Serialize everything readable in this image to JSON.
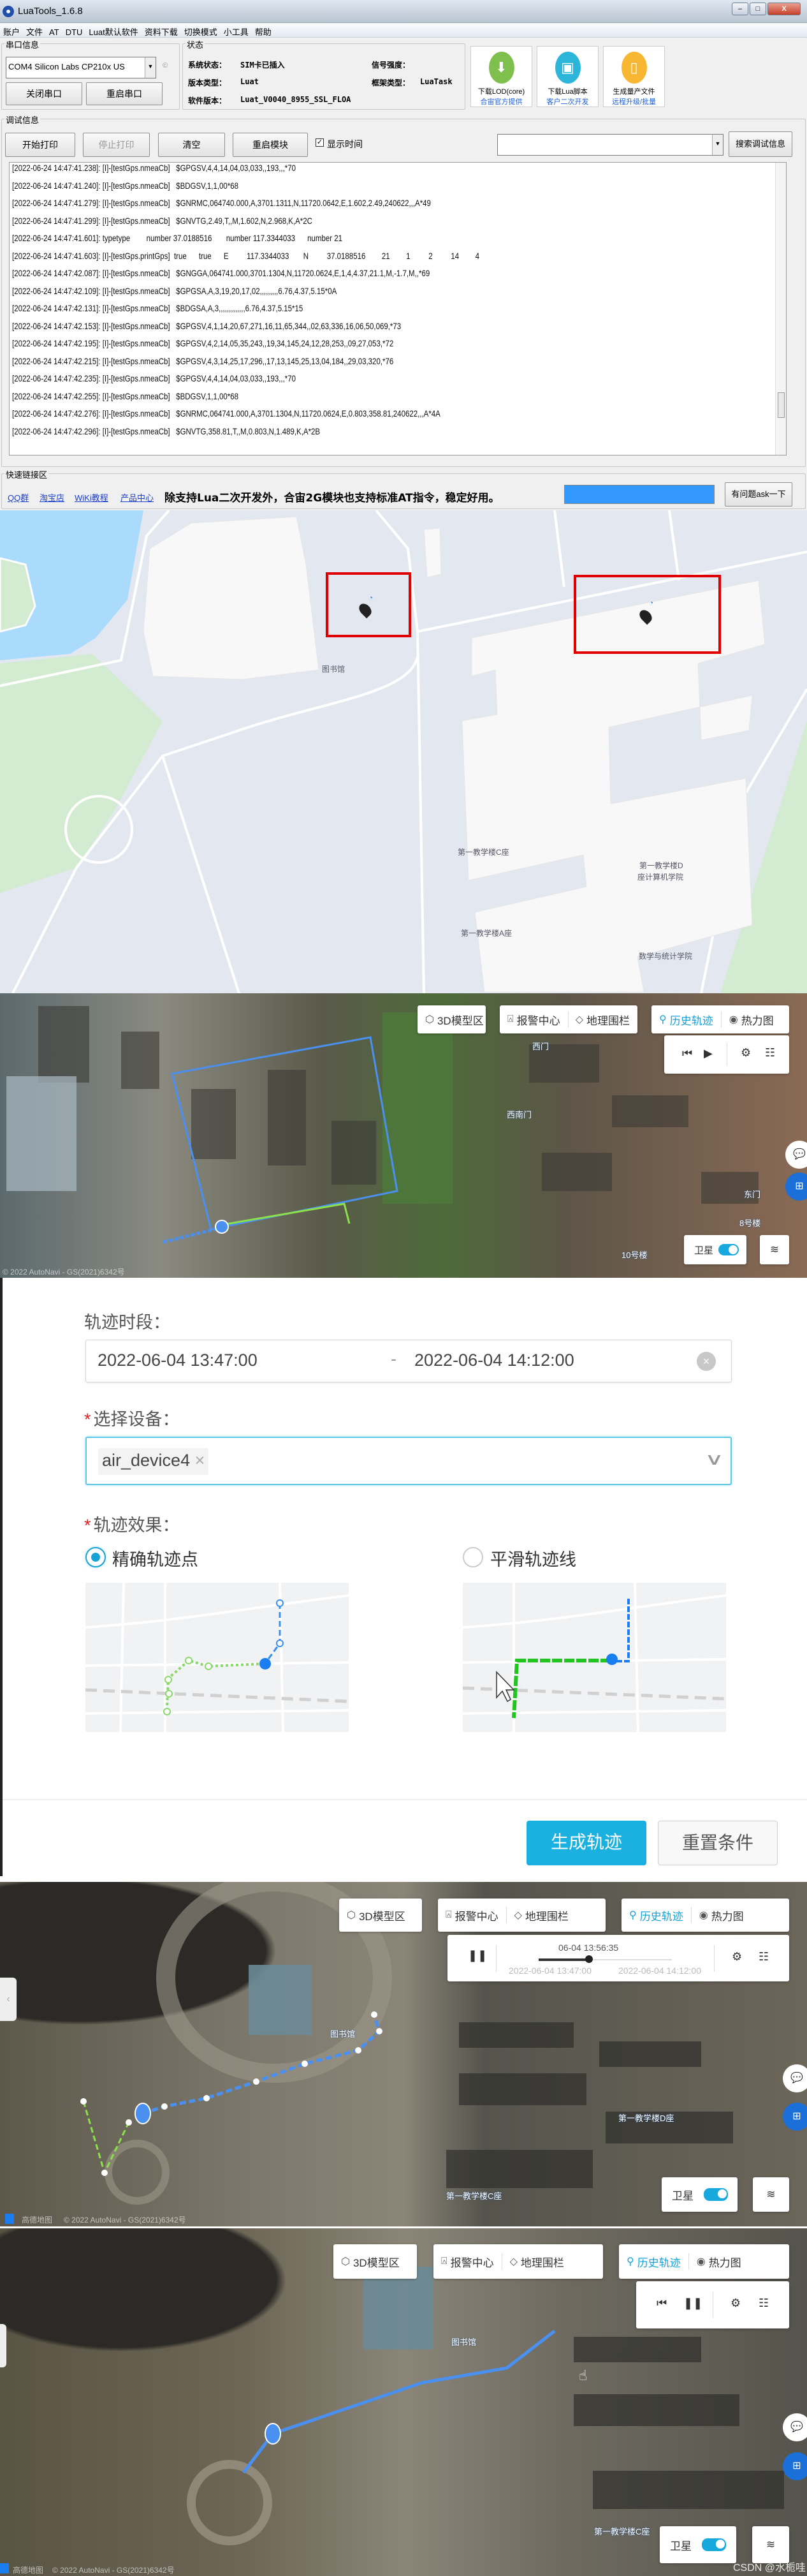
{
  "luatools": {
    "title": "LuaTools_1.6.8",
    "window_buttons": [
      "–",
      "□",
      "X"
    ],
    "menu": [
      "账户",
      "文件",
      "AT",
      "DTU",
      "Luat默认软件",
      "资料下载",
      "切换模式",
      "小工具",
      "帮助"
    ],
    "serial": {
      "group_label": "串口信息",
      "port": "COM4 Silicon Labs CP210x US",
      "close_btn": "关闭串口",
      "restart_btn": "重启串口"
    },
    "status": {
      "group_label": "状态",
      "sys_label": "系统状态：",
      "sys_value": "SIM卡已插入",
      "signal_label": "信号强度：",
      "signal_value": "",
      "ver_type_label": "版本类型：",
      "ver_type_value": "Luat",
      "frame_label": "框架类型：",
      "frame_value": "LuaTask",
      "sw_label": "软件版本：",
      "sw_value": "Luat_V0040_8955_SSL_FLOA"
    },
    "big_buttons": [
      {
        "line1": "下载LOD(core)",
        "line2": "合宙官方提供",
        "color": "#7fbf4d",
        "icon": "download-arrow-icon"
      },
      {
        "line1": "下载Lua脚本",
        "line2": "客户二次开发",
        "color": "#2bb5d8",
        "icon": "script-icon"
      },
      {
        "line1": "生成量产文件",
        "line2": "远程升级/批量",
        "color": "#f7b733",
        "icon": "file-icon"
      }
    ],
    "debug": {
      "group_label": "调试信息",
      "buttons": [
        "开始打印",
        "停止打印",
        "清空",
        "重启模块"
      ],
      "show_time_label": "显示时间",
      "show_time_checked": true,
      "search_value": "",
      "search_btn": "搜索调试信息"
    },
    "logs": [
      "[2022-06-24 14:47:41.238]: [I]-[testGps.nmeaCb]   $GPGSV,4,4,14,04,03,033,,193,,,*70",
      "[2022-06-24 14:47:41.240]: [I]-[testGps.nmeaCb]   $BDGSV,1,1,00*68",
      "[2022-06-24 14:47:41.279]: [I]-[testGps.nmeaCb]   $GNRMC,064740.000,A,3701.1311,N,11720.0642,E,1.602,2.49,240622,,,A*49",
      "[2022-06-24 14:47:41.299]: [I]-[testGps.nmeaCb]   $GNVTG,2.49,T,,M,1.602,N,2.968,K,A*2C",
      "[2022-06-24 14:47:41.601]: typetype        number 37.0188516       number 117.3344033      number 21",
      "[2022-06-24 14:47:41.603]: [I]-[testGps.printGps]  true      true      E         117.3344033       N         37.0188516        21        1         2         14        4",
      "[2022-06-24 14:47:42.087]: [I]-[testGps.nmeaCb]   $GNGGA,064741.000,3701.1304,N,11720.0624,E,1,4,4.37,21.1,M,-1.7,M,,*69",
      "[2022-06-24 14:47:42.109]: [I]-[testGps.nmeaCb]   $GPGSA,A,3,19,20,17,02,,,,,,,,,6.76,4.37,5.15*0A",
      "[2022-06-24 14:47:42.131]: [I]-[testGps.nmeaCb]   $BDGSA,A,3,,,,,,,,,,,,,6.76,4.37,5.15*15",
      "[2022-06-24 14:47:42.153]: [I]-[testGps.nmeaCb]   $GPGSV,4,1,14,20,67,271,16,11,65,344,,02,63,336,16,06,50,069,*73",
      "[2022-06-24 14:47:42.195]: [I]-[testGps.nmeaCb]   $GPGSV,4,2,14,05,35,243,,19,34,145,24,12,28,253,,09,27,053,*72",
      "[2022-06-24 14:47:42.215]: [I]-[testGps.nmeaCb]   $GPGSV,4,3,14,25,17,296,,17,13,145,25,13,04,184,,29,03,320,*76",
      "[2022-06-24 14:47:42.235]: [I]-[testGps.nmeaCb]   $GPGSV,4,4,14,04,03,033,,193,,,*70",
      "[2022-06-24 14:47:42.255]: [I]-[testGps.nmeaCb]   $BDGSV,1,1,00*68",
      "[2022-06-24 14:47:42.276]: [I]-[testGps.nmeaCb]   $GNRMC,064741.000,A,3701.1304,N,11720.0624,E,0.803,358.81,240622,,,A*4A",
      "[2022-06-24 14:47:42.296]: [I]-[testGps.nmeaCb]   $GNVTG,358.81,T,,M,0.803,N,1.489,K,A*2B"
    ],
    "quick": {
      "group_label": "快速链接区",
      "links": [
        "QQ群",
        "淘宝店",
        "WiKi教程",
        "产品中心"
      ],
      "slogan": "除支持Lua二次开发外，合宙2G模块也支持标准AT指令，稳定好用。",
      "ask_btn": "有问题ask一下",
      "progress_color": "#3399ff"
    }
  },
  "map1": {
    "labels": [
      "图书馆",
      "第一教学楼C座",
      "第一教学楼D",
      "座计算机学院",
      "第一教学楼A座",
      "数学与统计学院"
    ],
    "highlight_color": "#e00000"
  },
  "toolbar": {
    "model3d": "3D模型区",
    "alarm": "报警中心",
    "geofence": "地理围栏",
    "history": "历史轨迹",
    "heat": "热力图",
    "satellite": "卫星",
    "accent": "#17a2d8"
  },
  "sat1": {
    "labels": [
      "西门",
      "西南门",
      "东门",
      "8号楼",
      "10号楼"
    ],
    "attribution": "© 2022 AutoNavi - GS(2021)6342号"
  },
  "sat2": {
    "labels": [
      "图书馆",
      "第一教学楼D座",
      "第一教学楼C座"
    ],
    "logo": "高德地图",
    "attribution": "© 2022 AutoNavi - GS(2021)6342号",
    "playback": {
      "current": "06-04 13:56:35",
      "start": "2022-06-04 13:47:00",
      "end": "2022-06-04 14:12:00",
      "progress_percent": 38
    }
  },
  "sat3": {
    "labels": [
      "图书馆",
      "第一教学楼C座"
    ],
    "logo": "高德地图",
    "attribution": "© 2022 AutoNavi - GS(2021)6342号",
    "watermark": "CSDN @水栀哇"
  },
  "form": {
    "period_label": "轨迹时段：",
    "start": "2022-06-04 13:47:00",
    "sep": "-",
    "end": "2022-06-04 14:12:00",
    "device_label": "选择设备：",
    "device_tag": "air_device4",
    "tag_close": "×",
    "effect_label": "轨迹效果：",
    "required_mark": "*",
    "options": [
      {
        "label": "精确轨迹点",
        "selected": true
      },
      {
        "label": "平滑轨迹线",
        "selected": false
      }
    ],
    "generate_btn": "生成轨迹",
    "reset_btn": "重置条件",
    "primary_color": "#1ab0e0"
  }
}
